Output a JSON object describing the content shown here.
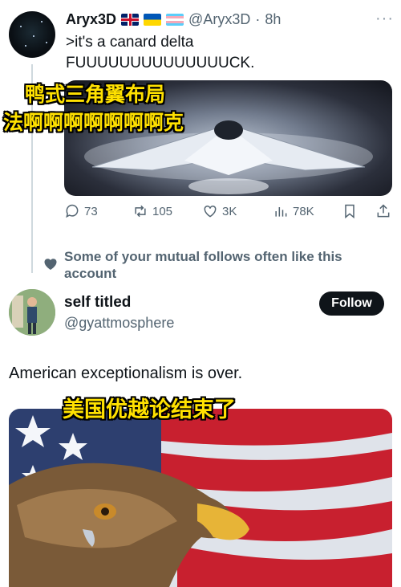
{
  "tweet": {
    "display_name": "Aryx3D",
    "flags": [
      "uk-flag",
      "ukraine-flag",
      "trans-flag"
    ],
    "handle": "@Aryx3D",
    "separator": "·",
    "time": "8h",
    "more": "···",
    "text_lines": [
      ">it's a canard delta",
      "FUUUUUUUUUUUUUUCK."
    ],
    "media_caption_lines": [
      "鸭式三角翼布局",
      "法啊啊啊啊啊啊啊克"
    ],
    "stats": {
      "replies": "73",
      "reposts": "105",
      "likes": "3K",
      "views": "78K"
    }
  },
  "social_context": {
    "icon": "heart-icon",
    "text": "Some of your mutual follows often like this account"
  },
  "suggested_user": {
    "name": "self titled",
    "handle": "@gyattmosphere",
    "follow_label": "Follow"
  },
  "tweet2": {
    "text": "American exceptionalism is over.",
    "media_caption": "美国优越论结束了"
  },
  "colors": {
    "text": "#0f1419",
    "secondary": "#536471",
    "caption_fill": "#ffe100",
    "button_bg": "#0f1419"
  }
}
